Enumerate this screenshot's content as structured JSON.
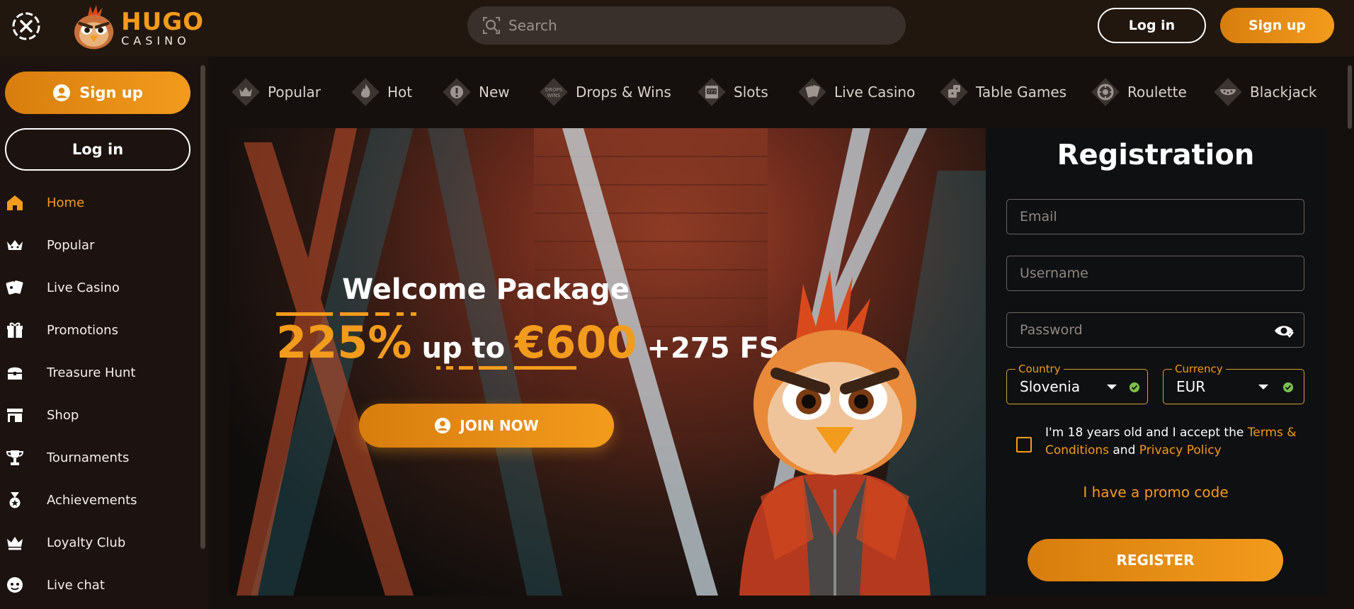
{
  "header": {
    "logo_main": "HUGO",
    "logo_sub": "CASINO",
    "search_placeholder": "Search",
    "login_label": "Log in",
    "signup_label": "Sign up"
  },
  "sidebar": {
    "signup_label": "Sign up",
    "login_label": "Log in",
    "items": [
      {
        "label": "Home",
        "icon": "home-icon",
        "active": true
      },
      {
        "label": "Popular",
        "icon": "crown-icon"
      },
      {
        "label": "Live Casino",
        "icon": "cards-icon"
      },
      {
        "label": "Promotions",
        "icon": "gift-icon"
      },
      {
        "label": "Treasure Hunt",
        "icon": "treasure-chest-icon"
      },
      {
        "label": "Shop",
        "icon": "shop-icon"
      },
      {
        "label": "Tournaments",
        "icon": "trophy-icon"
      },
      {
        "label": "Achievements",
        "icon": "medal-icon"
      },
      {
        "label": "Loyalty Club",
        "icon": "crown-icon"
      },
      {
        "label": "Live chat",
        "icon": "chat-icon"
      }
    ]
  },
  "categories": [
    {
      "label": "Popular",
      "icon": "crown-diamond-icon"
    },
    {
      "label": "Hot",
      "icon": "flame-icon"
    },
    {
      "label": "New",
      "icon": "exclamation-icon"
    },
    {
      "label": "Drops & Wins",
      "icon": "drops-wins-icon"
    },
    {
      "label": "Slots",
      "icon": "slot-machine-icon"
    },
    {
      "label": "Live Casino",
      "icon": "cards-icon"
    },
    {
      "label": "Table Games",
      "icon": "dice-icon"
    },
    {
      "label": "Roulette",
      "icon": "roulette-icon"
    },
    {
      "label": "Blackjack",
      "icon": "blackjack-table-icon"
    }
  ],
  "hero": {
    "title": "Welcome Package",
    "percent": "225%",
    "up_to": " up to ",
    "amount": "€600",
    "free_spins": " +275 FS",
    "join_label": "JOIN NOW"
  },
  "registration": {
    "title": "Registration",
    "email_placeholder": "Email",
    "username_placeholder": "Username",
    "password_placeholder": "Password",
    "country_label": "Country",
    "country_value": "Slovenia",
    "currency_label": "Currency",
    "currency_value": "EUR",
    "terms_prefix": "I'm 18 years old and I accept the ",
    "terms_link": "Terms & Conditions",
    "terms_and": " and ",
    "privacy_link": "Privacy Policy",
    "promo_label": "I have a promo code",
    "register_label": "REGISTER"
  },
  "colors": {
    "accent": "#f39b1c",
    "background": "#1a1210",
    "panel": "#0f1012",
    "valid": "#7cc04b"
  }
}
